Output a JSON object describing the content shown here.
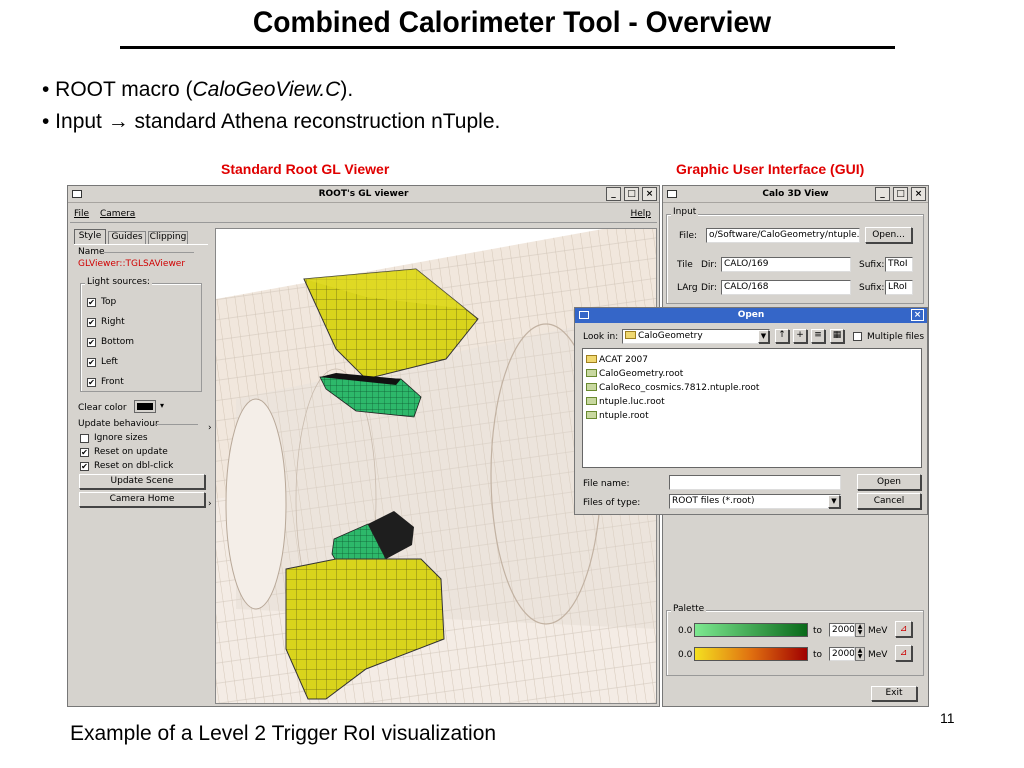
{
  "slide": {
    "title": "Combined Calorimeter Tool - Overview",
    "bullet1_pre": "• ROOT macro (",
    "bullet1_em": "CaloGeoView.C",
    "bullet1_post": ").",
    "bullet2": "• Input → standard Athena reconstruction nTuple.",
    "caption_left": "Standard Root GL Viewer",
    "caption_right": "Graphic User Interface (GUI)",
    "footer": "Example of a Level 2 Trigger RoI visualization",
    "page_number": "11"
  },
  "gl_viewer": {
    "title": "ROOT's GL viewer",
    "menu": {
      "file": "File",
      "camera": "Camera",
      "help": "Help"
    },
    "tabs": [
      "Style",
      "Guides",
      "Clipping"
    ],
    "name_label": "Name",
    "name_value": "GLViewer::TGLSAViewer",
    "light_sources_label": "Light sources:",
    "lights": [
      {
        "label": "Top",
        "checked": true
      },
      {
        "label": "Right",
        "checked": true
      },
      {
        "label": "Bottom",
        "checked": true
      },
      {
        "label": "Left",
        "checked": true
      },
      {
        "label": "Front",
        "checked": true
      }
    ],
    "clear_color_label": "Clear color",
    "update_behaviour_label": "Update behaviour",
    "update_options": [
      {
        "label": "Ignore sizes",
        "checked": false
      },
      {
        "label": "Reset on update",
        "checked": true
      },
      {
        "label": "Reset on dbl-click",
        "checked": true
      }
    ],
    "update_scene_button": "Update Scene",
    "camera_home_button": "Camera Home",
    "colors": {
      "block_yellow": "#d9d41c",
      "block_green": "#2db86a",
      "block_black": "#222222"
    }
  },
  "calo_view": {
    "title": "Calo 3D View",
    "input_label": "Input",
    "file_label": "File:",
    "file_value": "o/Software/CaloGeometry/ntuple.roo",
    "open_button": "Open...",
    "tile_label": "Tile",
    "tile_dir_label": "Dir:",
    "tile_dir_value": "CALO/169",
    "tile_sufix_label": "Sufix:",
    "tile_sufix_value": "TRoI",
    "larg_label": "LArg",
    "larg_dir_label": "Dir:",
    "larg_dir_value": "CALO/168",
    "larg_sufix_label": "Sufix:",
    "larg_sufix_value": "LRoI",
    "palette_label": "Palette",
    "palette_rows": [
      {
        "min": "0.0",
        "to": "to",
        "max": "2000",
        "unit": "MeV"
      },
      {
        "min": "0.0",
        "to": "to",
        "max": "2000",
        "unit": "MeV"
      }
    ],
    "exit_button": "Exit"
  },
  "open_dialog": {
    "title": "Open",
    "look_in_label": "Look in:",
    "look_in_value": "CaloGeometry",
    "multiple_files_label": "Multiple files",
    "files": [
      {
        "name": "ACAT 2007",
        "icon": "folder-icon"
      },
      {
        "name": "CaloGeometry.root",
        "icon": "root-file-icon"
      },
      {
        "name": "CaloReco_cosmics.7812.ntuple.root",
        "icon": "root-file-icon"
      },
      {
        "name": "ntuple.luc.root",
        "icon": "root-file-icon"
      },
      {
        "name": "ntuple.root",
        "icon": "root-file-icon"
      }
    ],
    "file_name_label": "File name:",
    "file_name_value": "",
    "files_of_type_label": "Files of type:",
    "files_of_type_value": "ROOT files (*.root)",
    "open_button": "Open",
    "cancel_button": "Cancel",
    "title_color": "#3566c8"
  }
}
